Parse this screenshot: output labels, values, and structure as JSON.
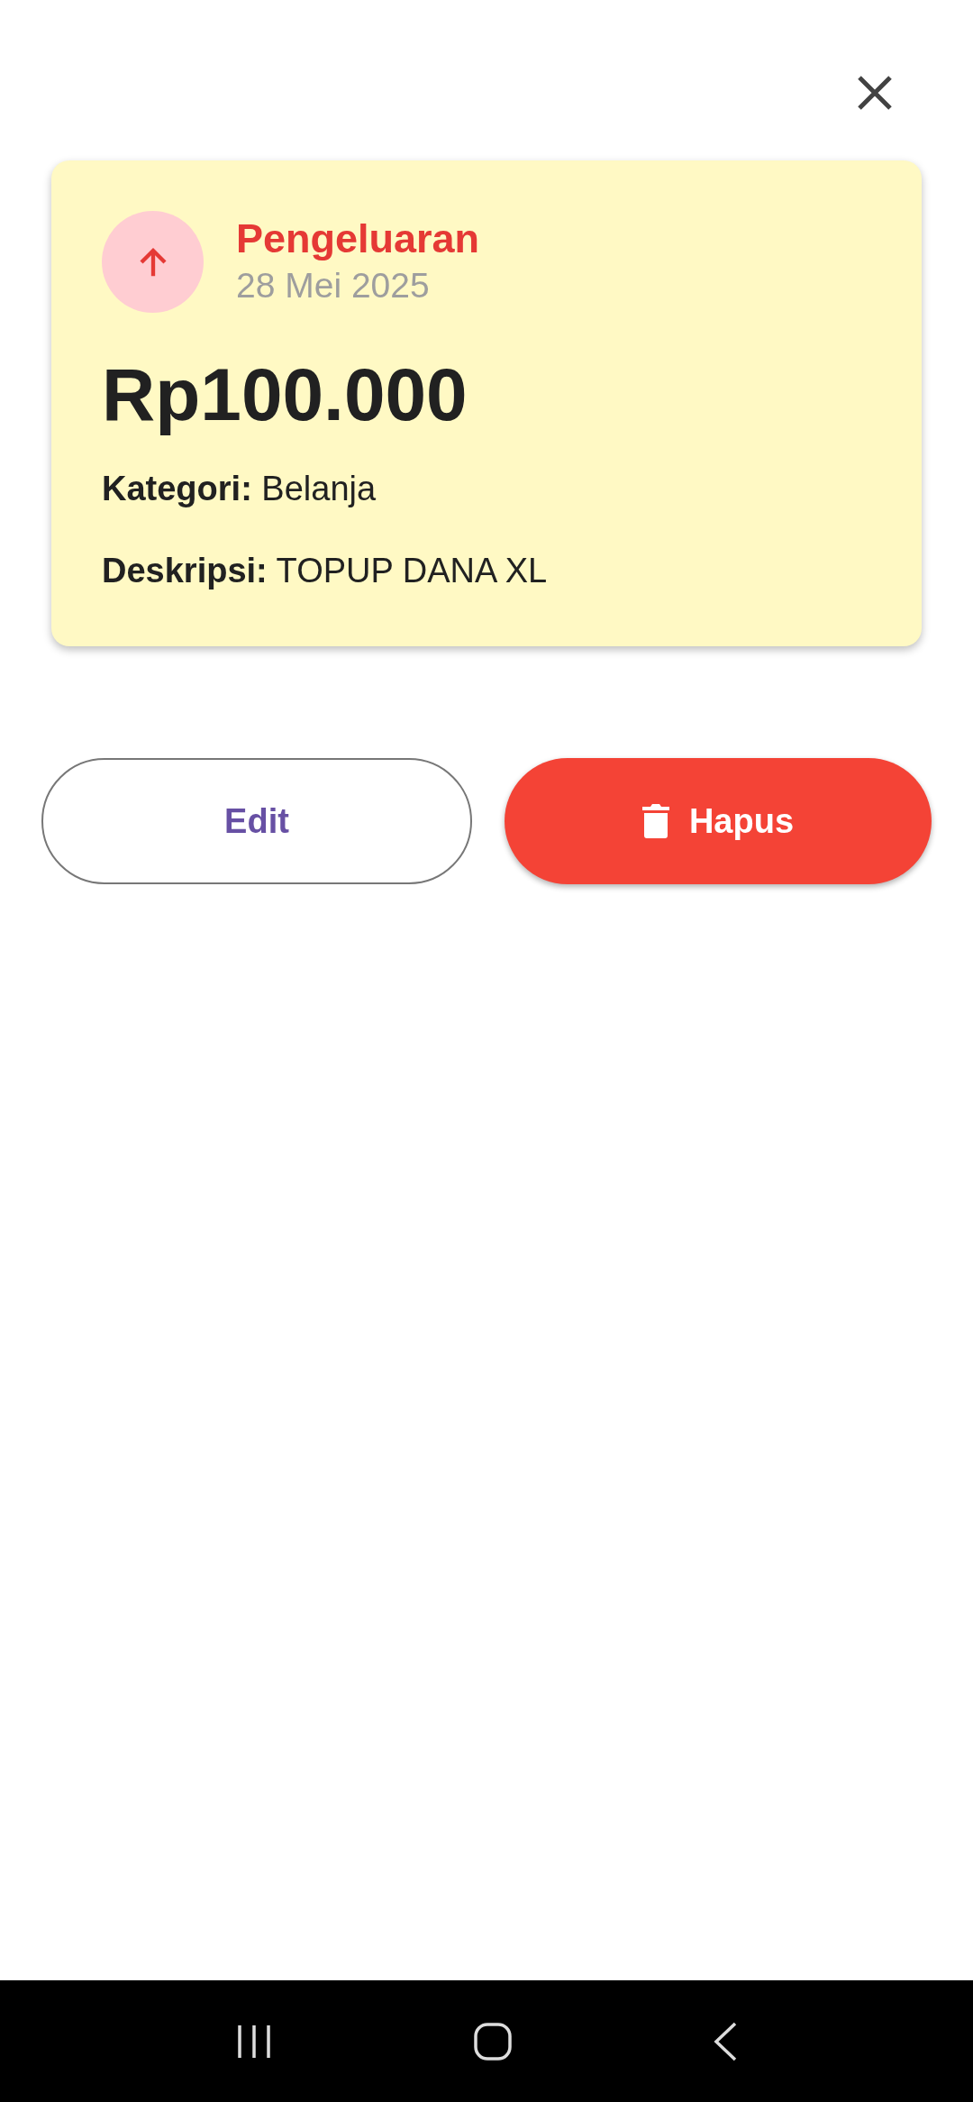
{
  "transaction": {
    "kind": "expense",
    "type_label": "Pengeluaran",
    "date": "28 Mei 2025",
    "amount": "Rp100.000",
    "details": [
      {
        "text": "**Kategori:** Belanja"
      },
      {
        "text": "**Deskripsi:** TOPUP DANA XL"
      }
    ]
  },
  "buttons": [
    {
      "label": "Edit",
      "kind": "outlined"
    },
    {
      "label": "Hapus",
      "kind": "danger"
    }
  ]
}
